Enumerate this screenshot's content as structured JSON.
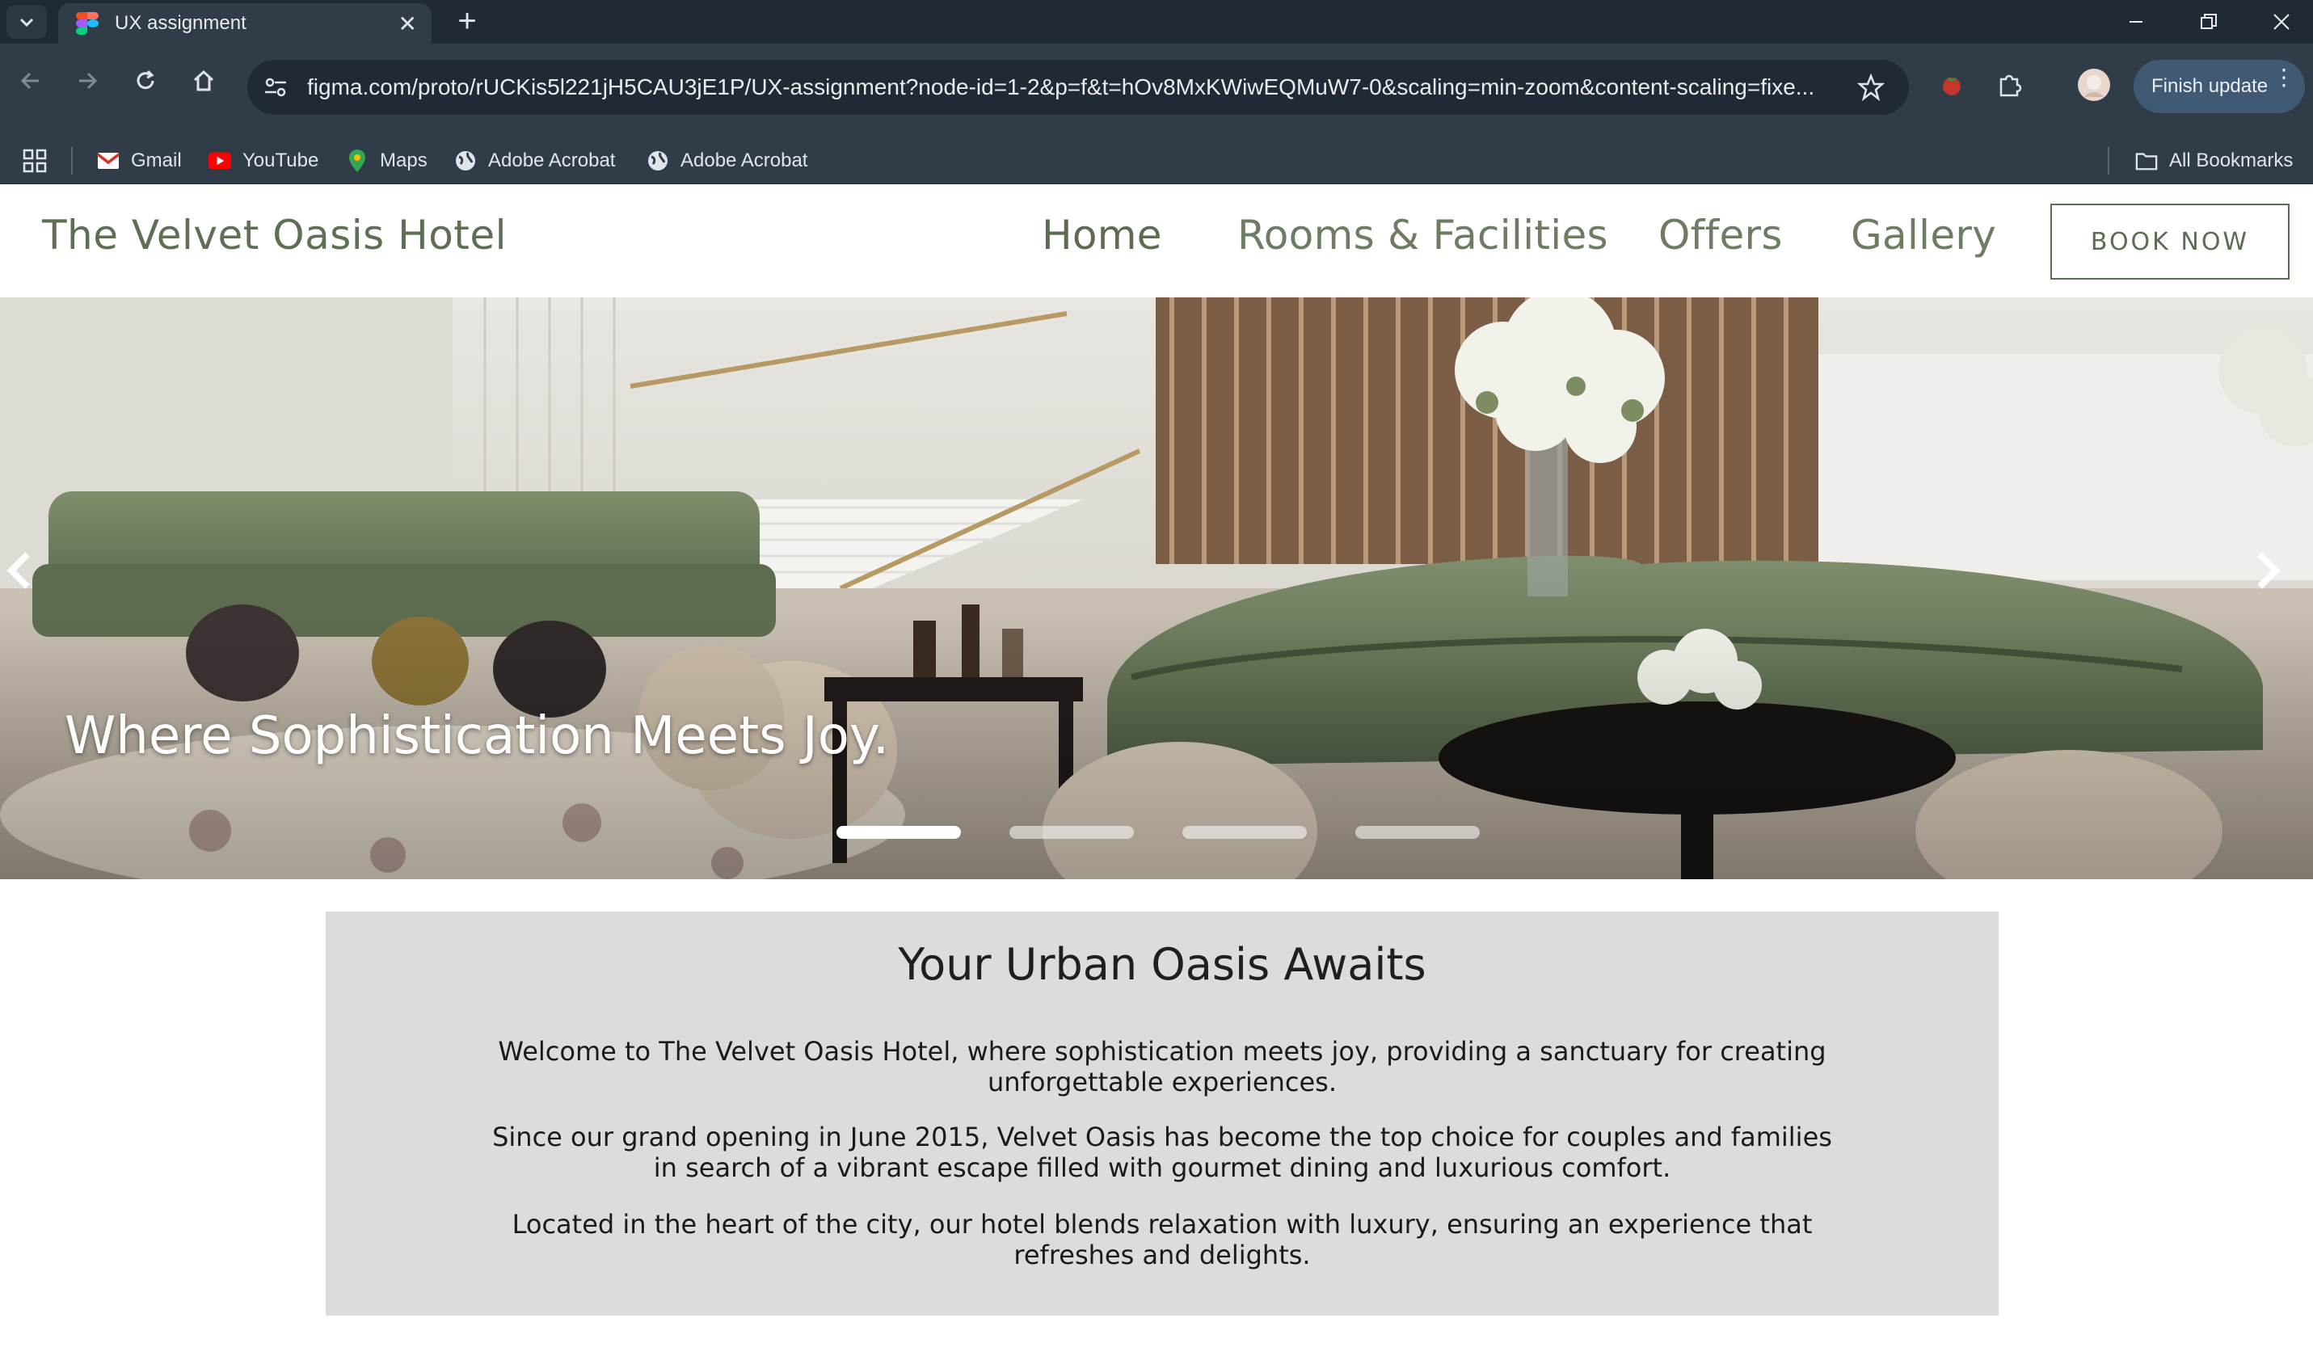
{
  "browser": {
    "tab_title": "UX assignment",
    "url": "figma.com/proto/rUCKis5l221jH5CAU3jE1P/UX-assignment?node-id=1-2&p=f&t=hOv8MxKWiwEQMuW7-0&scaling=min-zoom&content-scaling=fixe...",
    "finish_update_label": "Finish update",
    "bookmarks": [
      {
        "label": "Gmail",
        "icon": "gmail-icon"
      },
      {
        "label": "YouTube",
        "icon": "youtube-icon"
      },
      {
        "label": "Maps",
        "icon": "maps-icon"
      },
      {
        "label": "Adobe Acrobat",
        "icon": "globe-icon"
      },
      {
        "label": "Adobe Acrobat",
        "icon": "globe-icon"
      }
    ],
    "all_bookmarks_label": "All Bookmarks"
  },
  "site": {
    "brand": "The Velvet Oasis Hotel",
    "nav": [
      {
        "label": "Home",
        "active": true
      },
      {
        "label": "Rooms & Facilities",
        "active": false
      },
      {
        "label": "Offers",
        "active": false
      },
      {
        "label": "Gallery",
        "active": false
      }
    ],
    "book_button": "BOOK NOW",
    "hero": {
      "caption": "Where Sophistication Meets Joy.",
      "slide_count": 4,
      "active_slide": 1
    },
    "intro": {
      "heading": "Your Urban Oasis Awaits",
      "paragraphs": [
        "Welcome to The Velvet Oasis Hotel, where sophistication meets joy, providing a sanctuary for creating unforgettable experiences.",
        "Since our grand opening in June 2015, Velvet Oasis has become the top choice for couples and families in search of a vibrant escape filled with gourmet dining and luxurious comfort.",
        "Located in the heart of the city, our hotel blends relaxation with luxury, ensuring an experience that refreshes and delights."
      ]
    }
  },
  "colors": {
    "brand_green": "#5d6f55",
    "browser_dark": "#1f2a34",
    "browser_mid": "#303d49",
    "intro_bg": "#dcdcdc"
  }
}
